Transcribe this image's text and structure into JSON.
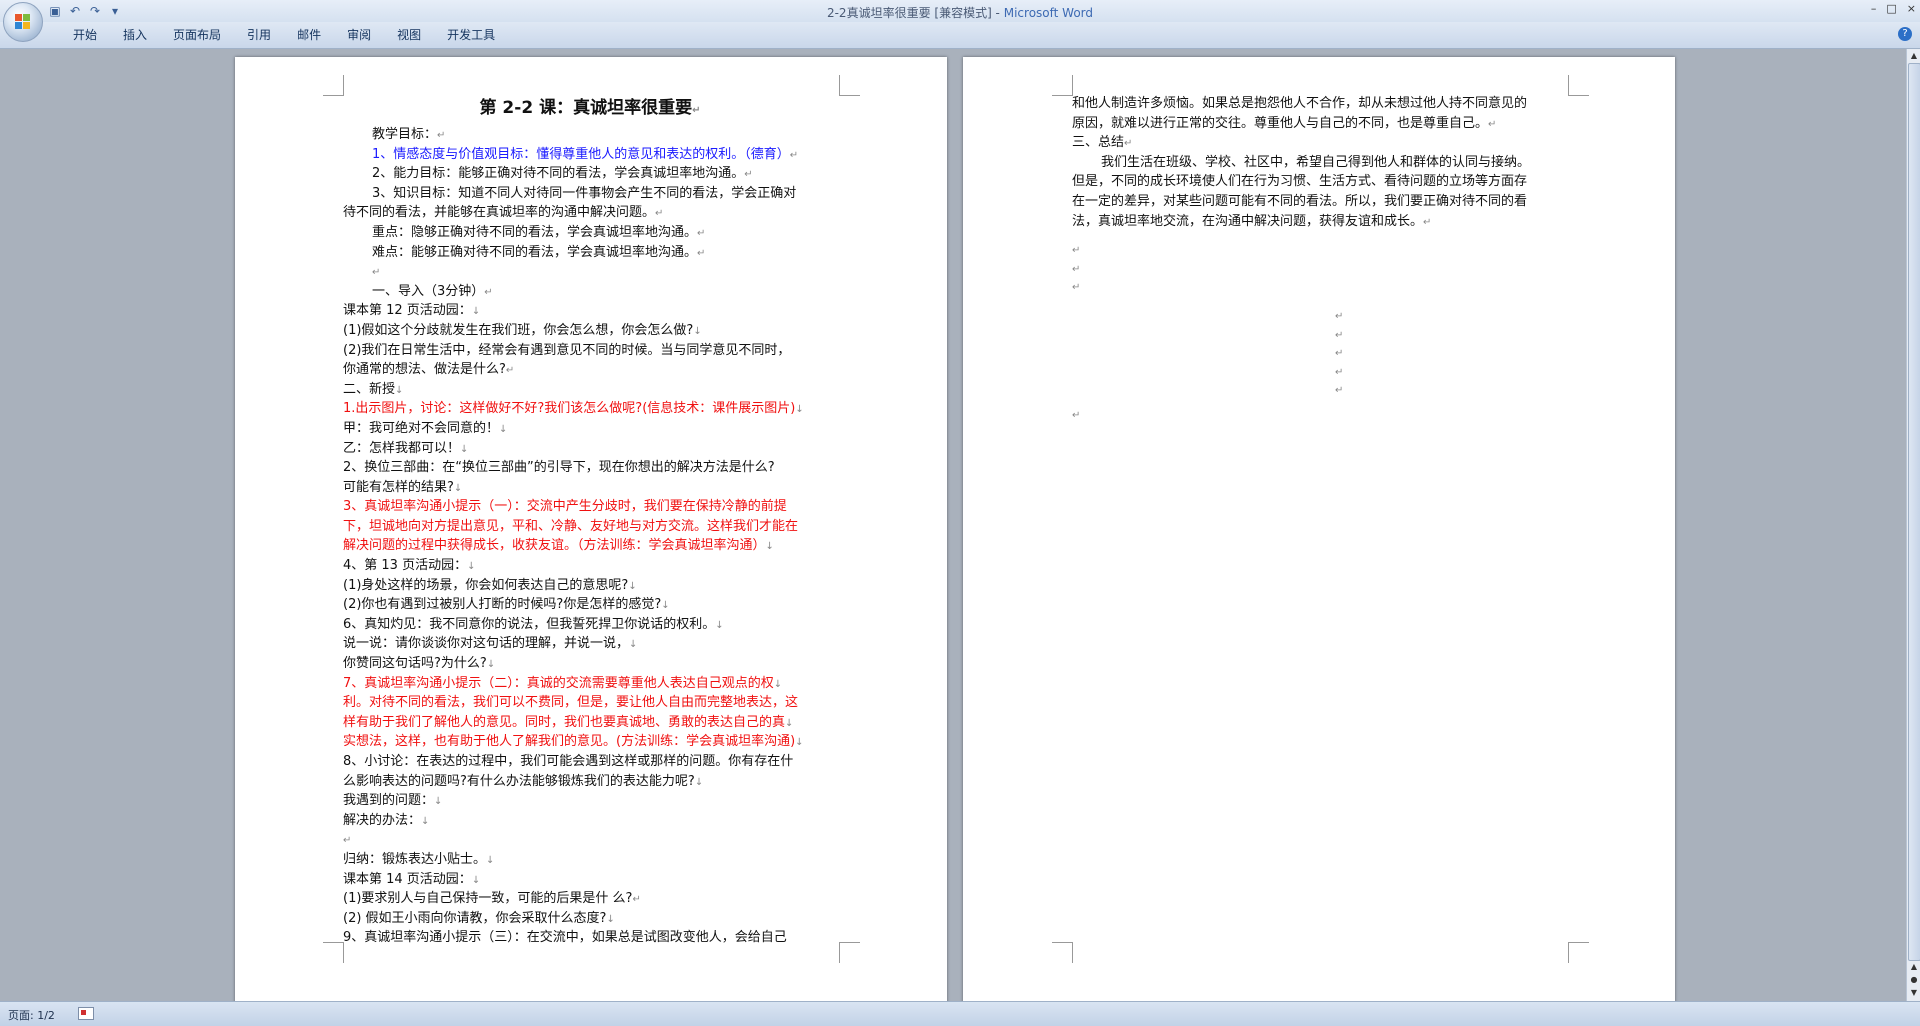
{
  "window": {
    "title_doc": "2-2真诚坦率很重要 [兼容模式] -",
    "title_app": "Microsoft Word",
    "controls": [
      "–",
      "□",
      "×"
    ]
  },
  "quick_access": {
    "icons": [
      "save-icon",
      "undo-icon",
      "redo-icon",
      "customize-icon"
    ],
    "glyphs": [
      "▣",
      "↶",
      "↷",
      "▾"
    ]
  },
  "ribbon": {
    "tabs": [
      "开始",
      "插入",
      "页面布局",
      "引用",
      "邮件",
      "审阅",
      "视图",
      "开发工具"
    ],
    "help": "?"
  },
  "page_left": {
    "title": "第 2-2 课：真诚坦率很重要",
    "lines": [
      {
        "t": "教学目标：",
        "cls": "ind",
        "m": "↵"
      },
      {
        "t": "1、情感态度与价值观目标：懂得尊重他人的意见和表达的权利。（德育）",
        "cls": "ind blue",
        "m": "↵"
      },
      {
        "t": "2、能力目标：能够正确对待不同的看法，学会真诚坦率地沟通。",
        "cls": "ind",
        "m": "↵"
      },
      {
        "t": "3、知识目标：知道不同人对待同一件事物会产生不同的看法，学会正确对",
        "cls": "ind",
        "m": ""
      },
      {
        "t": "待不同的看法，并能够在真诚坦率的沟通中解决问题。",
        "cls": "",
        "m": "↵"
      },
      {
        "t": "重点：隐够正确对待不同的看法，学会真诚坦率地沟通。",
        "cls": "ind",
        "m": "↵"
      },
      {
        "t": "难点：能够正确对待不同的看法，学会真诚坦率地沟通。",
        "cls": "ind",
        "m": "↵"
      },
      {
        "t": "",
        "cls": "ind",
        "m": "↵"
      },
      {
        "t": "一、导入（3分钟）",
        "cls": "ind",
        "m": "↵"
      },
      {
        "t": "课本第 12 页活动园：",
        "cls": "",
        "m": "↓"
      },
      {
        "t": "(1)假如这个分歧就发生在我们班，你会怎么想，你会怎么做?",
        "cls": "",
        "m": "↓"
      },
      {
        "t": "(2)我们在日常生活中，经常会有遇到意见不同的时候。当与同学意见不同时，",
        "cls": "",
        "m": ""
      },
      {
        "t": "你通常的想法、做法是什么?",
        "cls": "",
        "m": "↵"
      },
      {
        "t": "二、新授",
        "cls": "",
        "m": "↓"
      },
      {
        "t": "1.出示图片，讨论：这样做好不好?我们该怎么做呢?(信息技术：课件展示图片)",
        "cls": "red",
        "m": "↓"
      },
      {
        "t": "甲：我可绝对不会同意的！",
        "cls": "",
        "m": "↓"
      },
      {
        "t": "乙：怎样我都可以！",
        "cls": "",
        "m": "↓"
      },
      {
        "t": "2、换位三部曲：在“换位三部曲”的引导下，现在你想出的解决方法是什么?",
        "cls": "",
        "m": ""
      },
      {
        "t": "可能有怎样的结果?",
        "cls": "",
        "m": "↓"
      },
      {
        "t": "3、真诚坦率沟通小提示（一）：交流中产生分歧时，我们要在保持冷静的前提",
        "cls": "red",
        "m": ""
      },
      {
        "t": "下，坦诚地向对方提出意见，平和、冷静、友好地与对方交流。这样我们才能在",
        "cls": "red",
        "m": ""
      },
      {
        "t": "解决问题的过程中获得成长，收获友谊。（方法训练：学会真诚坦率沟通）",
        "cls": "red",
        "m": "↓"
      },
      {
        "t": "4、第 13 页活动园：",
        "cls": "",
        "m": "↓"
      },
      {
        "t": "(1)身处这样的场景，你会如何表达自己的意思呢?",
        "cls": "",
        "m": "↓"
      },
      {
        "t": "(2)你也有遇到过被别人打断的时候吗?你是怎样的感觉?",
        "cls": "",
        "m": "↓"
      },
      {
        "t": "6、真知灼见：我不同意你的说法，但我誓死捍卫你说话的权利。",
        "cls": "",
        "m": "↓"
      },
      {
        "t": "说一说：请你谈谈你对这句话的理解，并说一说，",
        "cls": "",
        "m": "↓"
      },
      {
        "t": "你赞同这句话吗?为什么?",
        "cls": "",
        "m": "↓"
      },
      {
        "t": "7、真诚坦率沟通小提示（二）：真诚的交流需要尊重他人表达自己观点的权",
        "cls": "red",
        "m": "↓"
      },
      {
        "t": "利。对待不同的看法，我们可以不费同，但是，要让他人自由而完整地表达，这",
        "cls": "red",
        "m": ""
      },
      {
        "t": "样有助于我们了解他人的意见。同时，我们也要真诚地、勇敢的表达自己的真",
        "cls": "red",
        "m": "↓"
      },
      {
        "t": "实想法，这样，也有助于他人了解我们的意见。(方法训练：学会真诚坦率沟通)",
        "cls": "red",
        "m": "↓"
      },
      {
        "t": "8、小讨论：在表达的过程中，我们可能会遇到这样或那样的问题。你有存在什",
        "cls": "",
        "m": ""
      },
      {
        "t": "么影响表达的问题吗?有什么办法能够锻炼我们的表达能力呢?",
        "cls": "",
        "m": "↓"
      },
      {
        "t": "我遇到的问题：",
        "cls": "",
        "m": "↓"
      },
      {
        "t": "解决的办法：",
        "cls": "",
        "m": "↓"
      },
      {
        "t": "",
        "cls": "",
        "m": "↵"
      },
      {
        "t": "归纳：锻炼表达小贴士。",
        "cls": "",
        "m": "↓"
      },
      {
        "t": "课本第 14 页活动园：",
        "cls": "",
        "m": "↓"
      },
      {
        "t": "(1)要求别人与自己保持一致，可能的后果是什  么?",
        "cls": "",
        "m": "↵"
      },
      {
        "t": "(2)    假如王小雨向你请教，你会采取什么态度?",
        "cls": "",
        "m": "↓"
      },
      {
        "t": "9、真诚坦率沟通小提示（三）：在交流中，如果总是试图改变他人，会给自己",
        "cls": "",
        "m": ""
      }
    ]
  },
  "page_right": {
    "lines": [
      {
        "t": "和他人制造许多烦恼。如果总是抱怨他人不合作，却从未想过他人持不同意见的",
        "cls": "",
        "m": ""
      },
      {
        "t": "原因，就难以进行正常的交往。尊重他人与自己的不同，也是尊重自己。",
        "cls": "",
        "m": "↵"
      },
      {
        "t": "三、总结",
        "cls": "",
        "m": "↵"
      },
      {
        "t": "我们生活在班级、学校、社区中，希望自己得到他人和群体的认同与接纳。",
        "cls": "ind",
        "m": ""
      },
      {
        "t": "但是，不同的成长环境使人们在行为习惯、生活方式、看待问题的立场等方面存",
        "cls": "",
        "m": ""
      },
      {
        "t": "在一定的差异，对某些问题可能有不同的看法。所以，我们要正确对待不同的看",
        "cls": "",
        "m": ""
      },
      {
        "t": "法，真诚坦率地交流，在沟通中解决问题，获得友谊和成长。",
        "cls": "",
        "m": "↵"
      }
    ],
    "blank_marks_left": [
      "↵",
      "↵",
      "↵"
    ],
    "blank_marks_center": [
      "↵",
      "↵",
      "↵",
      "↵",
      "↵"
    ],
    "final_mark": "↵"
  },
  "status": {
    "page_label": "页面: 1/2"
  }
}
